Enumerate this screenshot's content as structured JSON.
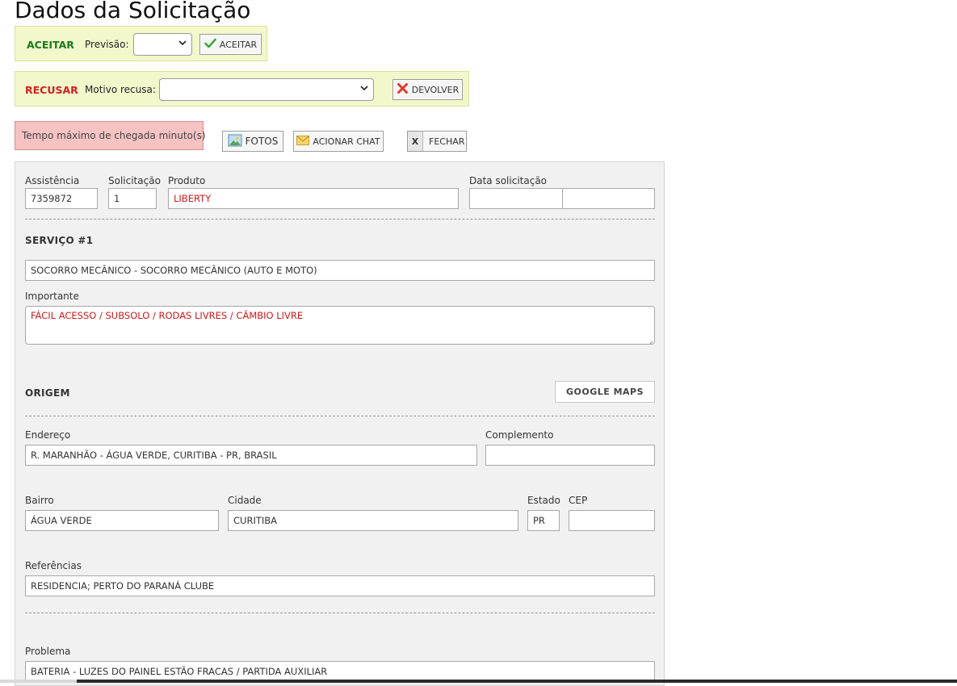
{
  "page": {
    "title": "Dados da Solicitação"
  },
  "accept": {
    "heading": "ACEITAR",
    "forecast_label": "Previsão:",
    "forecast_value": "",
    "button_label": "ACEITAR"
  },
  "refuse": {
    "heading": "RECUSAR",
    "reason_label": "Motivo recusa:",
    "reason_value": "",
    "button_label": "DEVOLVER"
  },
  "alert": {
    "text": "Tempo máximo de chegada minuto(s)"
  },
  "toolbar": {
    "photos_label": "FOTOS",
    "chat_label": "ACIONAR CHAT",
    "close_label": "FECHAR",
    "close_icon_glyph": "X"
  },
  "form": {
    "assistance": {
      "label": "Assistência",
      "value": "7359872"
    },
    "request": {
      "label": "Solicitação",
      "value": "1"
    },
    "product": {
      "label": "Produto",
      "value": "LIBERTY"
    },
    "request_date": {
      "label": "Data solicitação",
      "date_value": "",
      "time_value": ""
    },
    "service": {
      "title": "SERVIÇO #1",
      "value": "SOCORRO MECÂNICO - SOCORRO MECÂNICO (AUTO E MOTO)",
      "important_label": "Importante",
      "important_value": "FÁCIL ACESSO / SUBSOLO /  RODAS LIVRES /  CÃMBIO LIVRE"
    },
    "origin": {
      "title": "ORIGEM",
      "maps_button": "GOOGLE MAPS",
      "address": {
        "label": "Endereço",
        "value": "R. MARANHÃO - ÁGUA VERDE, CURITIBA - PR, BRASIL"
      },
      "complement": {
        "label": "Complemento",
        "value": ""
      },
      "district": {
        "label": "Bairro",
        "value": "ÁGUA VERDE"
      },
      "city": {
        "label": "Cidade",
        "value": "CURITIBA"
      },
      "state": {
        "label": "Estado",
        "value": "PR"
      },
      "zip": {
        "label": "CEP",
        "value": ""
      },
      "references": {
        "label": "Referências",
        "value": "RESIDENCIA;  PERTO DO PARANÁ CLUBE"
      }
    },
    "problem": {
      "label": "Problema",
      "value": "BATERIA - LUZES DO PAINEL ESTÃO FRACAS /  PARTIDA AUXILIAR"
    }
  },
  "colors": {
    "accent_green": "#1a7a1a",
    "accent_red": "#d42020",
    "panel_yellow": "#f2f7cc",
    "alert_pink": "#f6c2c2",
    "value_red": "#cc1a1a"
  },
  "icons": {
    "accept": "check-icon",
    "refuse": "x-mark-icon",
    "photos": "image-icon",
    "chat": "envelope-icon",
    "close": "close-icon",
    "select": "chevron-down-icon"
  }
}
